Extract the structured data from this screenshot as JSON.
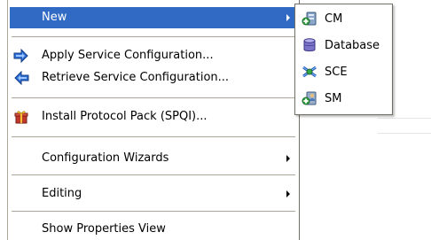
{
  "menu": {
    "items": [
      {
        "label": "New",
        "has_submenu": true,
        "selected": true,
        "icon": ""
      },
      {
        "label": "Apply Service Configuration...",
        "has_submenu": false,
        "icon": "apply-arrows-icon"
      },
      {
        "label": "Retrieve Service Configuration...",
        "has_submenu": false,
        "icon": "retrieve-arrows-icon"
      },
      {
        "label": "Install Protocol Pack (SPQI)...",
        "has_submenu": false,
        "icon": "gift-box-icon"
      },
      {
        "label": "Configuration Wizards",
        "has_submenu": true,
        "icon": ""
      },
      {
        "label": "Editing",
        "has_submenu": true,
        "icon": ""
      },
      {
        "label": "Show Properties View",
        "has_submenu": false,
        "icon": ""
      }
    ]
  },
  "submenu": {
    "items": [
      {
        "label": "CM",
        "icon": "cm-server-icon"
      },
      {
        "label": "Database",
        "icon": "database-icon"
      },
      {
        "label": "SCE",
        "icon": "sce-icon"
      },
      {
        "label": "SM",
        "icon": "sm-server-icon"
      }
    ]
  },
  "colors": {
    "selection": "#316ac5",
    "border": "#716f64",
    "separator": "#aca899"
  }
}
